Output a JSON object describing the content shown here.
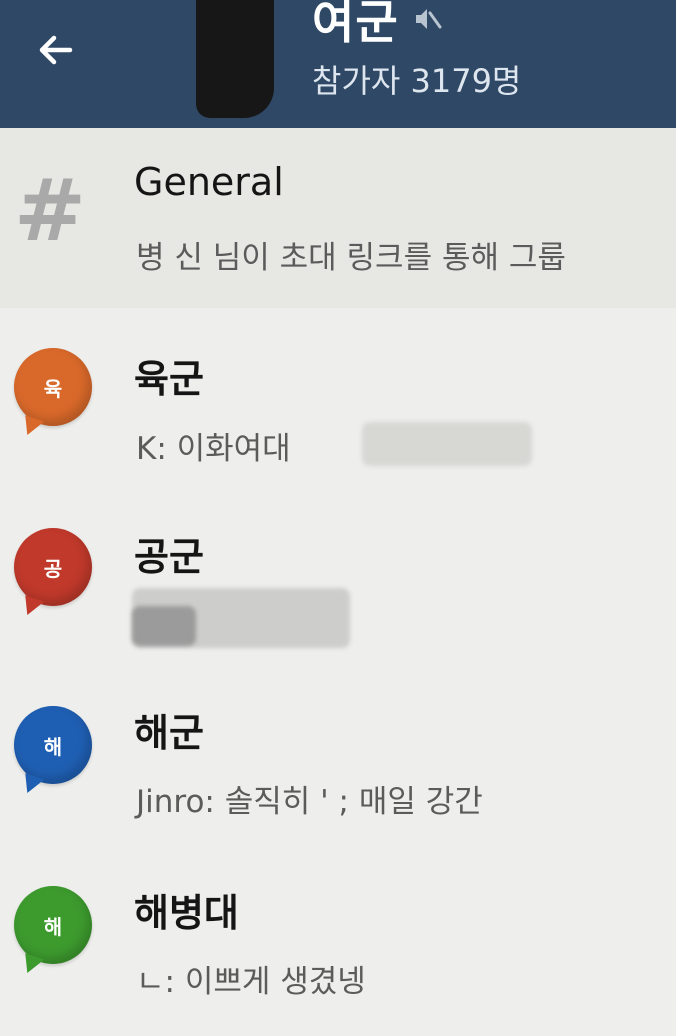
{
  "header": {
    "title": "여군",
    "subtitle": "참가자 3179명",
    "background": "#2f4865"
  },
  "chats": [
    {
      "title": "General",
      "preview": "병 신 님이 초대 링크를 통해 그룹",
      "icon": "hash-icon"
    },
    {
      "title": "육군",
      "preview": "K: 이화여대",
      "icon_label": "육",
      "color": "#d9692a"
    },
    {
      "title": "공군",
      "preview": "",
      "icon_label": "공",
      "color": "#c0392b"
    },
    {
      "title": "해군",
      "preview": "Jinro: 솔직히 ' ; 매일 강간",
      "icon_label": "해",
      "color": "#1f5fb3"
    },
    {
      "title": "해병대",
      "preview": "ㄴ: 이쁘게 생겼넹",
      "icon_label": "해",
      "color": "#3d9b2e"
    }
  ]
}
